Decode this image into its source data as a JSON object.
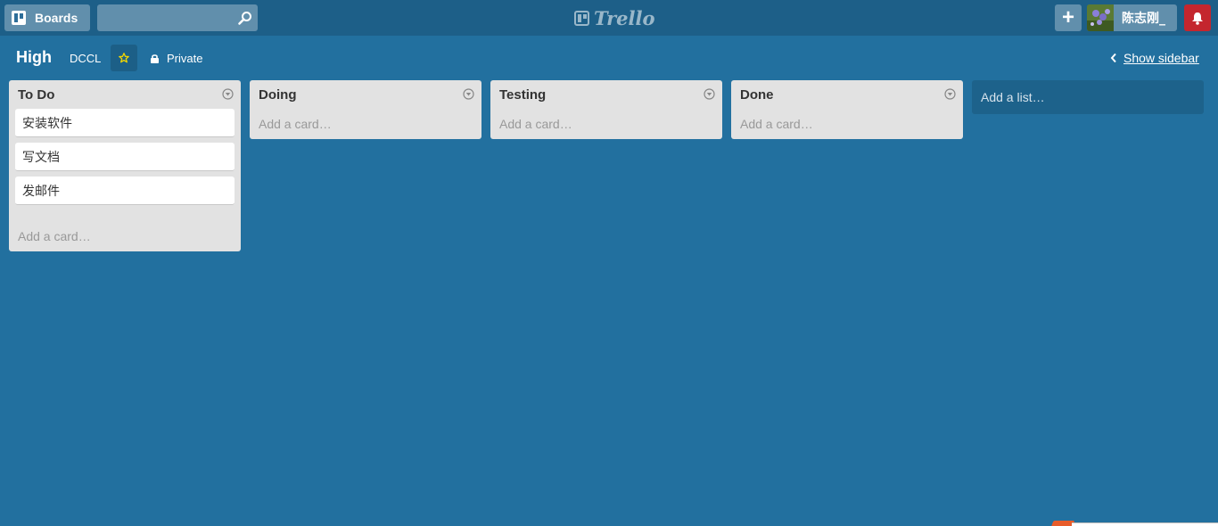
{
  "header": {
    "boards_label": "Boards",
    "search": {
      "value": "",
      "placeholder": ""
    },
    "logo_text": "Trello",
    "add_label": "+",
    "member_name": "陈志刚_",
    "icons": {
      "boards": "boards-icon",
      "search": "search-icon",
      "notifications": "bell-icon"
    },
    "colors": {
      "bar": "#1d5f88",
      "notification": "#c4262e"
    }
  },
  "board": {
    "title": "High",
    "organization": "DCCL",
    "privacy": "Private",
    "show_sidebar": "Show sidebar",
    "background_color": "#22709f"
  },
  "lists": [
    {
      "title": "To Do",
      "cards": [
        "安装软件",
        "写文档",
        "发邮件"
      ],
      "add_card": "Add a card…"
    },
    {
      "title": "Doing",
      "cards": [],
      "add_card": "Add a card…"
    },
    {
      "title": "Testing",
      "cards": [],
      "add_card": "Add a card…"
    },
    {
      "title": "Done",
      "cards": [],
      "add_card": "Add a card…"
    }
  ],
  "add_list": "Add a list…"
}
